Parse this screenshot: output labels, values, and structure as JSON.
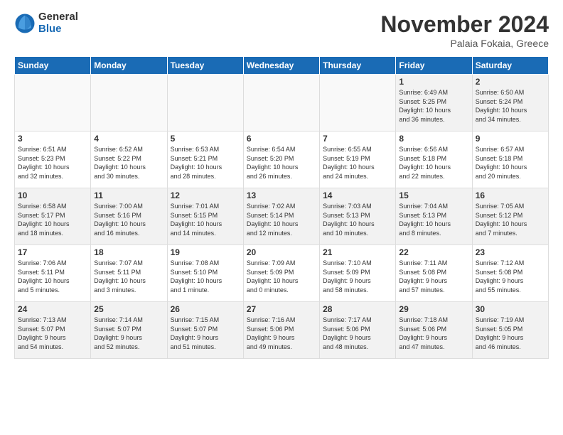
{
  "logo": {
    "general": "General",
    "blue": "Blue"
  },
  "title": "November 2024",
  "location": "Palaia Fokaia, Greece",
  "days_of_week": [
    "Sunday",
    "Monday",
    "Tuesday",
    "Wednesday",
    "Thursday",
    "Friday",
    "Saturday"
  ],
  "rows": [
    [
      {
        "num": "",
        "info": "",
        "empty": true
      },
      {
        "num": "",
        "info": "",
        "empty": true
      },
      {
        "num": "",
        "info": "",
        "empty": true
      },
      {
        "num": "",
        "info": "",
        "empty": true
      },
      {
        "num": "",
        "info": "",
        "empty": true
      },
      {
        "num": "1",
        "info": "Sunrise: 6:49 AM\nSunset: 5:25 PM\nDaylight: 10 hours\nand 36 minutes.",
        "empty": false
      },
      {
        "num": "2",
        "info": "Sunrise: 6:50 AM\nSunset: 5:24 PM\nDaylight: 10 hours\nand 34 minutes.",
        "empty": false
      }
    ],
    [
      {
        "num": "3",
        "info": "Sunrise: 6:51 AM\nSunset: 5:23 PM\nDaylight: 10 hours\nand 32 minutes.",
        "empty": false
      },
      {
        "num": "4",
        "info": "Sunrise: 6:52 AM\nSunset: 5:22 PM\nDaylight: 10 hours\nand 30 minutes.",
        "empty": false
      },
      {
        "num": "5",
        "info": "Sunrise: 6:53 AM\nSunset: 5:21 PM\nDaylight: 10 hours\nand 28 minutes.",
        "empty": false
      },
      {
        "num": "6",
        "info": "Sunrise: 6:54 AM\nSunset: 5:20 PM\nDaylight: 10 hours\nand 26 minutes.",
        "empty": false
      },
      {
        "num": "7",
        "info": "Sunrise: 6:55 AM\nSunset: 5:19 PM\nDaylight: 10 hours\nand 24 minutes.",
        "empty": false
      },
      {
        "num": "8",
        "info": "Sunrise: 6:56 AM\nSunset: 5:18 PM\nDaylight: 10 hours\nand 22 minutes.",
        "empty": false
      },
      {
        "num": "9",
        "info": "Sunrise: 6:57 AM\nSunset: 5:18 PM\nDaylight: 10 hours\nand 20 minutes.",
        "empty": false
      }
    ],
    [
      {
        "num": "10",
        "info": "Sunrise: 6:58 AM\nSunset: 5:17 PM\nDaylight: 10 hours\nand 18 minutes.",
        "empty": false
      },
      {
        "num": "11",
        "info": "Sunrise: 7:00 AM\nSunset: 5:16 PM\nDaylight: 10 hours\nand 16 minutes.",
        "empty": false
      },
      {
        "num": "12",
        "info": "Sunrise: 7:01 AM\nSunset: 5:15 PM\nDaylight: 10 hours\nand 14 minutes.",
        "empty": false
      },
      {
        "num": "13",
        "info": "Sunrise: 7:02 AM\nSunset: 5:14 PM\nDaylight: 10 hours\nand 12 minutes.",
        "empty": false
      },
      {
        "num": "14",
        "info": "Sunrise: 7:03 AM\nSunset: 5:13 PM\nDaylight: 10 hours\nand 10 minutes.",
        "empty": false
      },
      {
        "num": "15",
        "info": "Sunrise: 7:04 AM\nSunset: 5:13 PM\nDaylight: 10 hours\nand 8 minutes.",
        "empty": false
      },
      {
        "num": "16",
        "info": "Sunrise: 7:05 AM\nSunset: 5:12 PM\nDaylight: 10 hours\nand 7 minutes.",
        "empty": false
      }
    ],
    [
      {
        "num": "17",
        "info": "Sunrise: 7:06 AM\nSunset: 5:11 PM\nDaylight: 10 hours\nand 5 minutes.",
        "empty": false
      },
      {
        "num": "18",
        "info": "Sunrise: 7:07 AM\nSunset: 5:11 PM\nDaylight: 10 hours\nand 3 minutes.",
        "empty": false
      },
      {
        "num": "19",
        "info": "Sunrise: 7:08 AM\nSunset: 5:10 PM\nDaylight: 10 hours\nand 1 minute.",
        "empty": false
      },
      {
        "num": "20",
        "info": "Sunrise: 7:09 AM\nSunset: 5:09 PM\nDaylight: 10 hours\nand 0 minutes.",
        "empty": false
      },
      {
        "num": "21",
        "info": "Sunrise: 7:10 AM\nSunset: 5:09 PM\nDaylight: 9 hours\nand 58 minutes.",
        "empty": false
      },
      {
        "num": "22",
        "info": "Sunrise: 7:11 AM\nSunset: 5:08 PM\nDaylight: 9 hours\nand 57 minutes.",
        "empty": false
      },
      {
        "num": "23",
        "info": "Sunrise: 7:12 AM\nSunset: 5:08 PM\nDaylight: 9 hours\nand 55 minutes.",
        "empty": false
      }
    ],
    [
      {
        "num": "24",
        "info": "Sunrise: 7:13 AM\nSunset: 5:07 PM\nDaylight: 9 hours\nand 54 minutes.",
        "empty": false
      },
      {
        "num": "25",
        "info": "Sunrise: 7:14 AM\nSunset: 5:07 PM\nDaylight: 9 hours\nand 52 minutes.",
        "empty": false
      },
      {
        "num": "26",
        "info": "Sunrise: 7:15 AM\nSunset: 5:07 PM\nDaylight: 9 hours\nand 51 minutes.",
        "empty": false
      },
      {
        "num": "27",
        "info": "Sunrise: 7:16 AM\nSunset: 5:06 PM\nDaylight: 9 hours\nand 49 minutes.",
        "empty": false
      },
      {
        "num": "28",
        "info": "Sunrise: 7:17 AM\nSunset: 5:06 PM\nDaylight: 9 hours\nand 48 minutes.",
        "empty": false
      },
      {
        "num": "29",
        "info": "Sunrise: 7:18 AM\nSunset: 5:06 PM\nDaylight: 9 hours\nand 47 minutes.",
        "empty": false
      },
      {
        "num": "30",
        "info": "Sunrise: 7:19 AM\nSunset: 5:05 PM\nDaylight: 9 hours\nand 46 minutes.",
        "empty": false
      }
    ]
  ]
}
